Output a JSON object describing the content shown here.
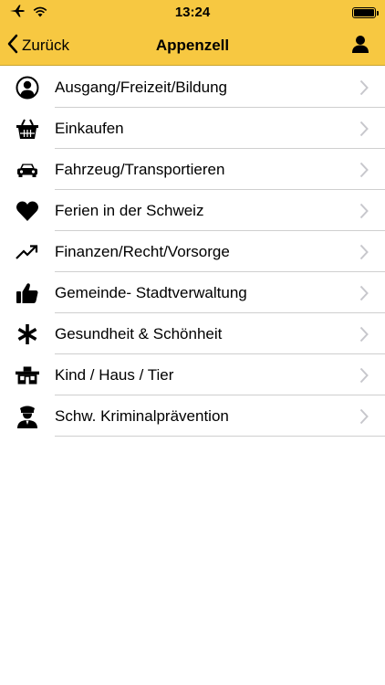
{
  "status_bar": {
    "time": "13:24",
    "icons": [
      "airplane-icon",
      "wifi-icon",
      "battery-icon"
    ]
  },
  "nav": {
    "back_label": "Zurück",
    "title": "Appenzell",
    "profile_icon": "person-icon"
  },
  "colors": {
    "bar_background": "#f7c841",
    "separator": "#cfcfcf",
    "chevron": "#c7c7cc"
  },
  "items": [
    {
      "label": "Ausgang/Freizeit/Bildung",
      "icon": "person-circle-icon"
    },
    {
      "label": "Einkaufen",
      "icon": "shopping-basket-icon"
    },
    {
      "label": "Fahrzeug/Transportieren",
      "icon": "car-icon"
    },
    {
      "label": "Ferien in der Schweiz",
      "icon": "heart-icon"
    },
    {
      "label": "Finanzen/Recht/Vorsorge",
      "icon": "trending-up-icon"
    },
    {
      "label": "Gemeinde- Stadtverwaltung",
      "icon": "thumbs-up-icon"
    },
    {
      "label": "Gesundheit & Schönheit",
      "icon": "asterisk-icon"
    },
    {
      "label": "Kind / Haus / Tier",
      "icon": "house-icon"
    },
    {
      "label": "Schw. Kriminalprävention",
      "icon": "police-officer-icon"
    }
  ]
}
